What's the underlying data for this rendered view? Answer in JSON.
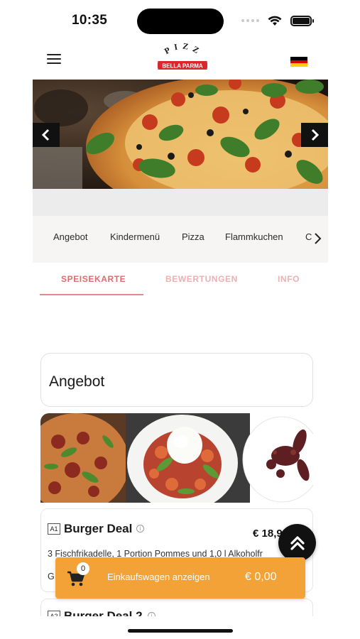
{
  "status_bar": {
    "time": "10:35"
  },
  "header": {
    "logo_top": "PIZZA",
    "logo_banner": "BELLA PARMA",
    "language_flag": "de-flag"
  },
  "categories": [
    "Angebot",
    "Kindermenü",
    "Pizza",
    "Flammkuchen",
    "C"
  ],
  "tabs": {
    "items": [
      "SPEISEKARTE",
      "BEWERTUNGEN",
      "INFO"
    ],
    "active": "SPEISEKARTE"
  },
  "section": {
    "title": "Angebot"
  },
  "products": [
    {
      "code": "A1",
      "name": "Burger Deal",
      "price": "€ 18,9",
      "description": "3 Fischfrikadelle, 1 Portion Pommes und 1,0 l Alkoholfr",
      "description_2": "G"
    },
    {
      "code": "A2",
      "name": "Burger Deal 2"
    }
  ],
  "cart": {
    "count": "0",
    "label": "Einkaufswagen anzeigen",
    "total": "€ 0,00"
  },
  "colors": {
    "accent_pink": "#e08a8d",
    "cart_orange": "#f3a237",
    "logo_red": "#d9272e"
  },
  "icons": {
    "menu": "hamburger-menu-icon",
    "prev": "chevron-left-icon",
    "next": "chevron-right-icon",
    "cart": "shopping-cart-icon",
    "scroll_top": "double-chevron-up-icon",
    "info": "info-circle-icon"
  }
}
